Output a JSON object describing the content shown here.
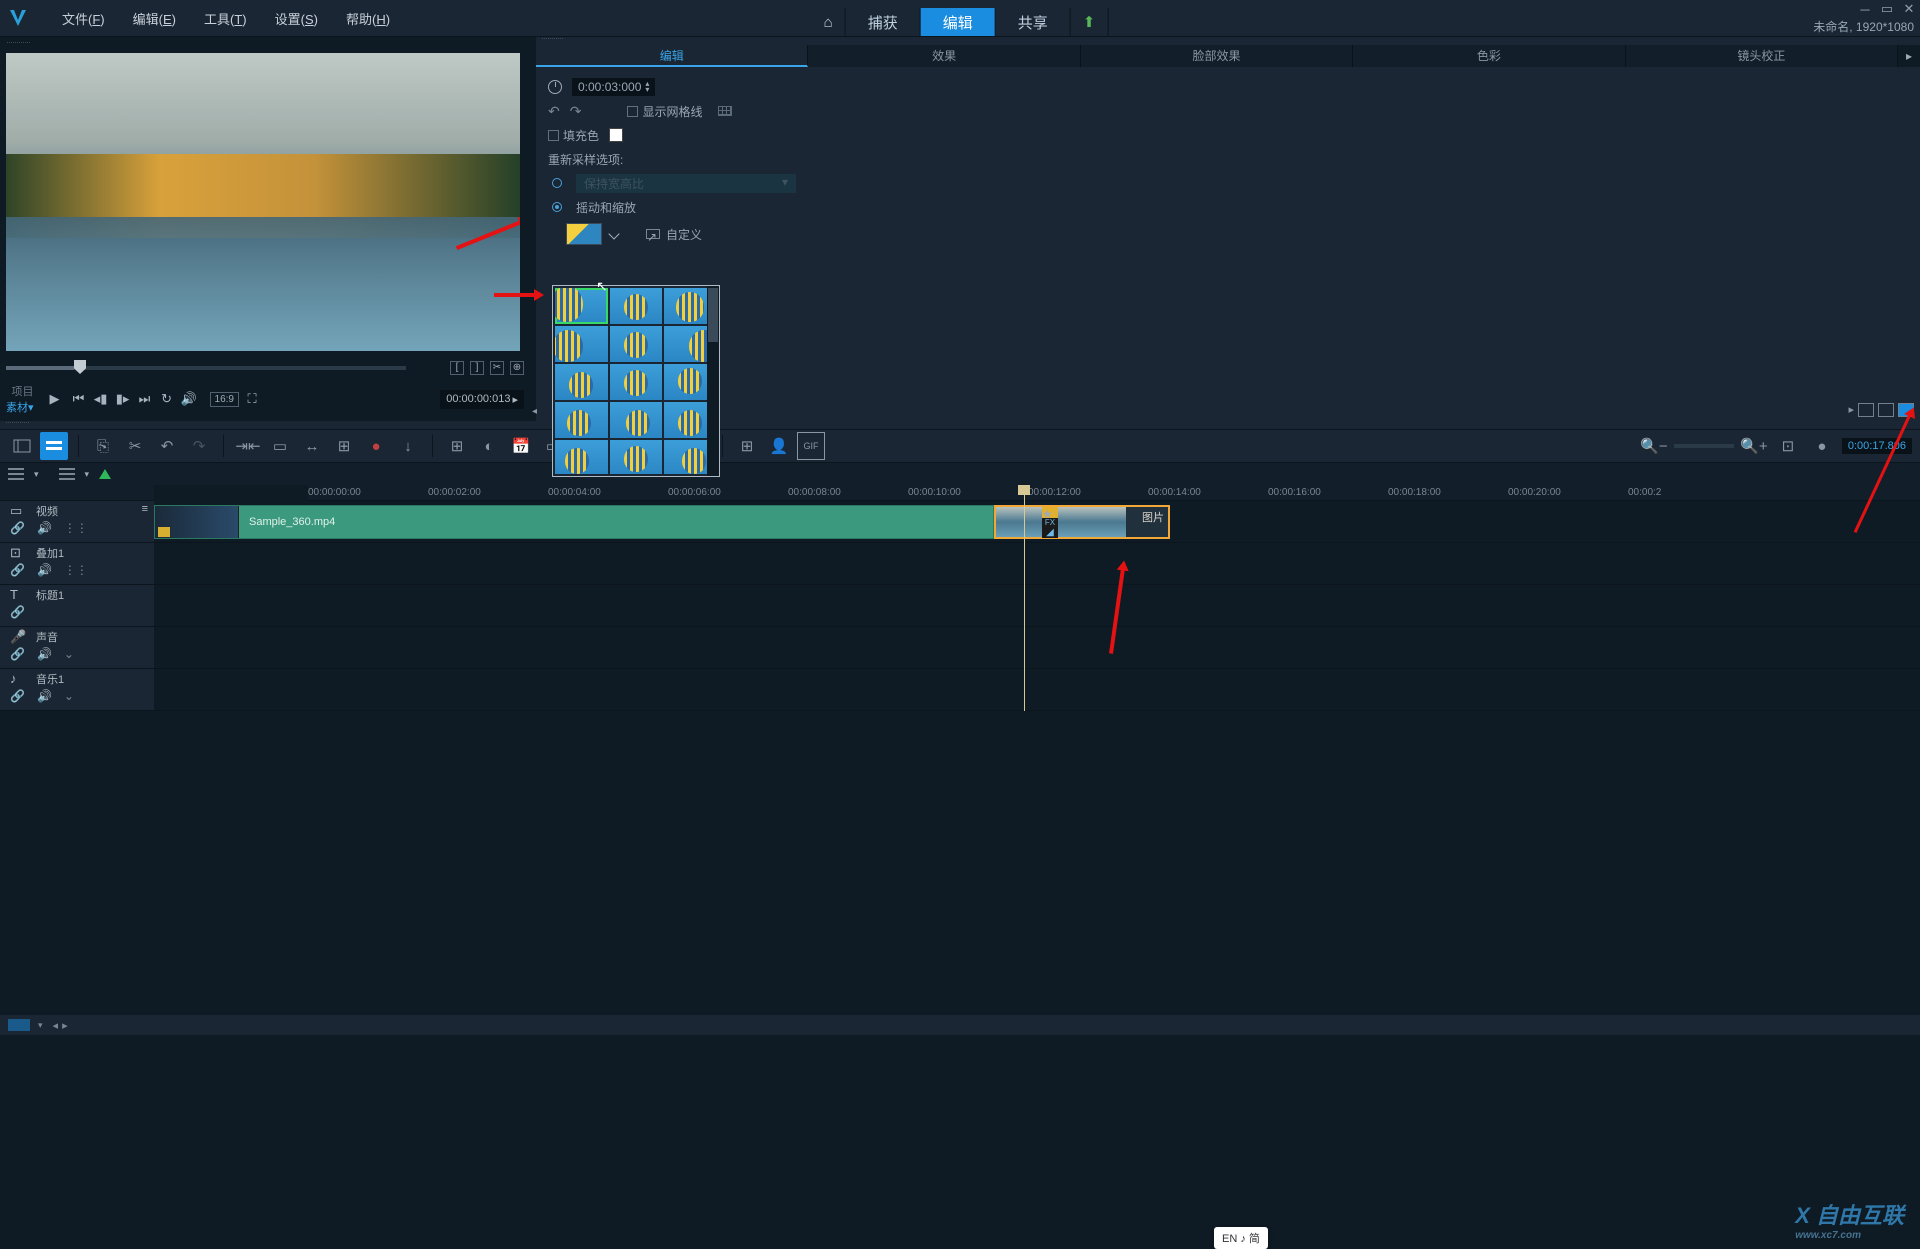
{
  "menu": {
    "items": [
      {
        "label": "文件(",
        "hotkey": "F",
        "end": ")"
      },
      {
        "label": "编辑(",
        "hotkey": "E",
        "end": ")"
      },
      {
        "label": "工具(",
        "hotkey": "T",
        "end": ")"
      },
      {
        "label": "设置(",
        "hotkey": "S",
        "end": ")"
      },
      {
        "label": "帮助(",
        "hotkey": "H",
        "end": ")"
      }
    ]
  },
  "center_tabs": {
    "capture": "捕获",
    "edit": "编辑",
    "share": "共享"
  },
  "project_status": "未命名, 1920*1080",
  "preview": {
    "project_label": "项目",
    "clip_label": "素材",
    "aspect": "16:9",
    "timecode": "00:00:00:013"
  },
  "props": {
    "tabs": [
      "编辑",
      "效果",
      "脸部效果",
      "色彩",
      "镜头校正"
    ],
    "duration_label": "",
    "duration_value": "0:00:03:000",
    "show_grid": "显示网格线",
    "fill_color": "填充色",
    "resample_label": "重新采样选项:",
    "keep_aspect": "保持宽高比",
    "pan_zoom": "摇动和缩放",
    "custom": "自定义"
  },
  "toolbar": {
    "timecode": "0:00:17.806"
  },
  "timeline": {
    "ticks": [
      "00:00:00:00",
      "00:00:02:00",
      "00:00:04:00",
      "00:00:06:00",
      "00:00:08:00",
      "00:00:10:00",
      "00:00:12:00",
      "00:00:14:00",
      "00:00:16:00",
      "00:00:18:00",
      "00:00:20:00",
      "00:00:2"
    ],
    "tracks": [
      {
        "name": "视频"
      },
      {
        "name": "叠加1"
      },
      {
        "name": "标题1"
      },
      {
        "name": "声音"
      },
      {
        "name": "音乐1"
      }
    ],
    "video_clip": "Sample_360.mp4",
    "image_clip": "图片"
  },
  "ime_badge": "EN ♪ 简",
  "watermark_main": "自由互联",
  "watermark_sub": "www.xc7.com"
}
